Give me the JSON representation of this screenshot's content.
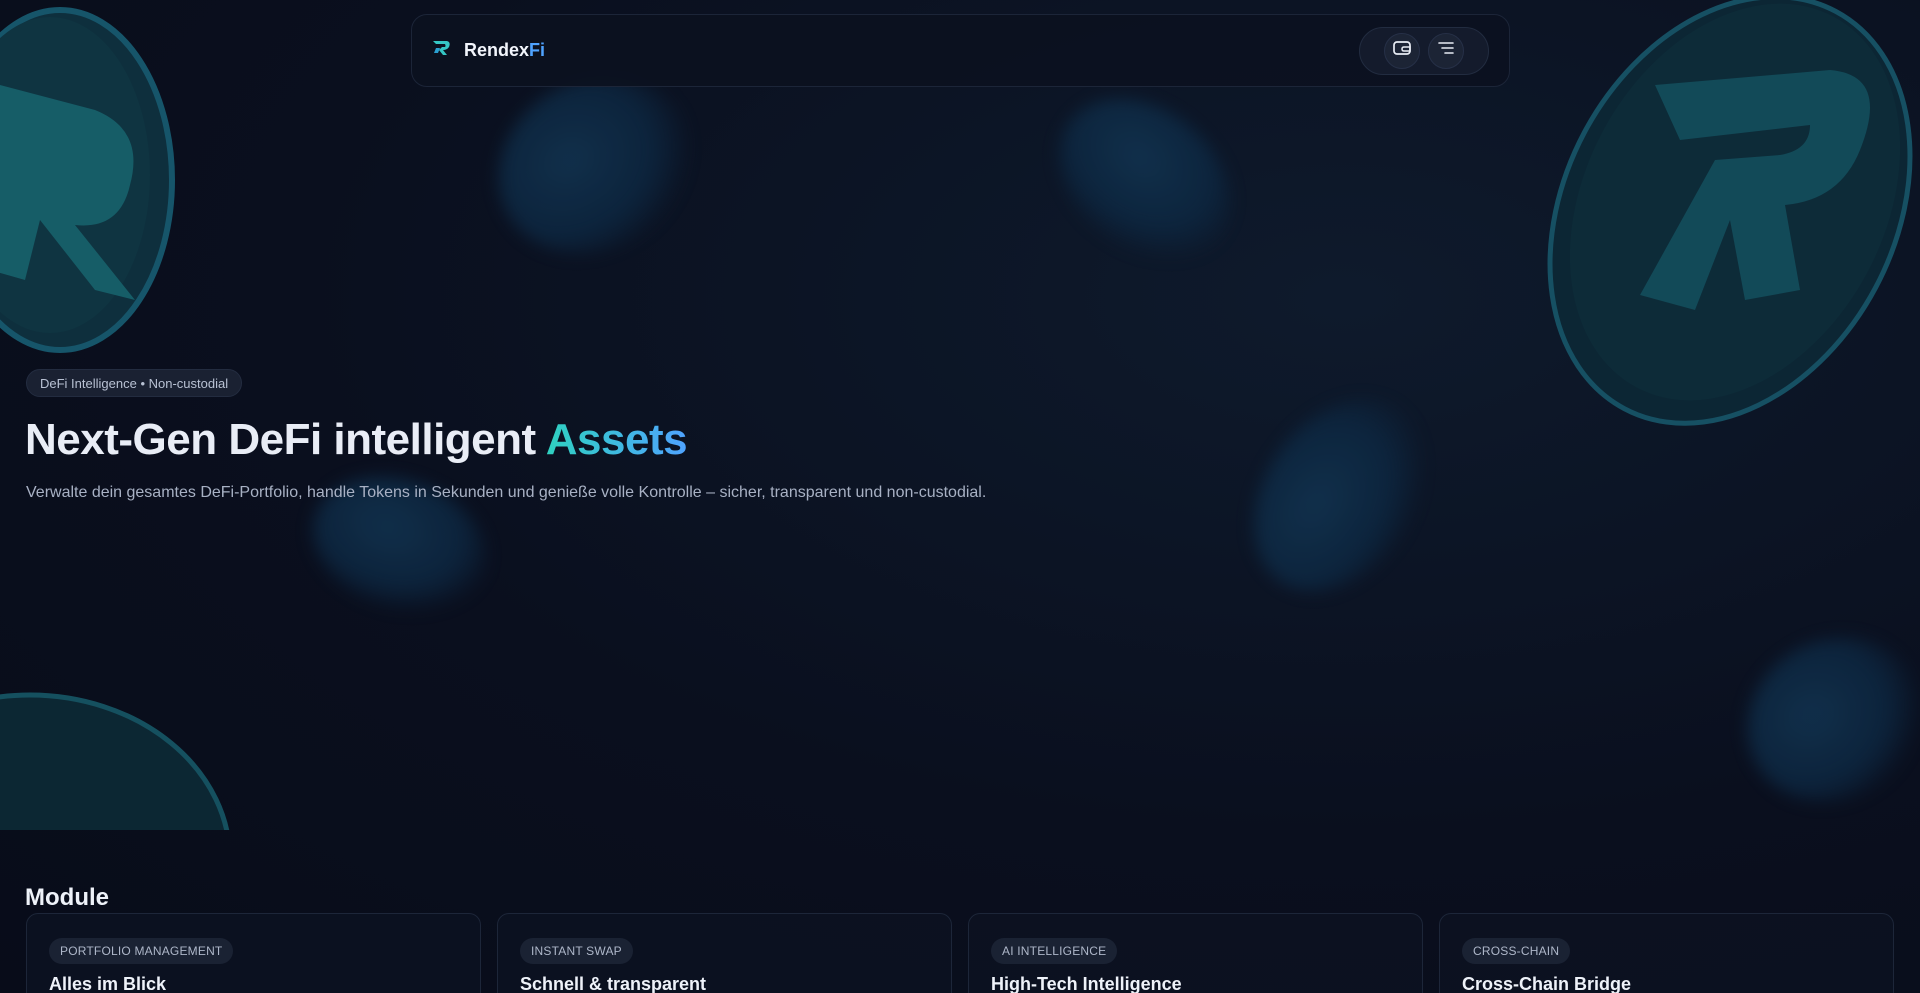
{
  "brand": {
    "name": "Rendex",
    "accent": "Fi",
    "logo_icon": "rendex-logo-icon"
  },
  "nav": {
    "actions": [
      {
        "icon": "wallet-icon"
      },
      {
        "icon": "menu-icon"
      }
    ]
  },
  "hero": {
    "badge": " DeFi Intelligence • Non-custodial",
    "title_main": "Next-Gen DeFi intelligent ",
    "title_accent": "Assets",
    "subtitle": "Verwalte dein gesamtes DeFi-Portfolio, handle Tokens in Sekunden und genieße volle Kontrolle – sicher, transparent und non-custodial."
  },
  "modules": {
    "title": "Module",
    "cards": [
      {
        "tag": "PORTFOLIO MANAGEMENT",
        "title": "Alles im Blick"
      },
      {
        "tag": "INSTANT SWAP",
        "title": "Schnell & transparent"
      },
      {
        "tag": "AI INTELLIGENCE",
        "title": "High-Tech Intelligence"
      },
      {
        "tag": "CROSS-CHAIN",
        "title": "Cross-Chain Bridge"
      }
    ]
  },
  "colors": {
    "background": "#0a0f1e",
    "accent_teal": "#2fd1c0",
    "accent_blue": "#4fa3ff",
    "coin": "#14505e"
  }
}
